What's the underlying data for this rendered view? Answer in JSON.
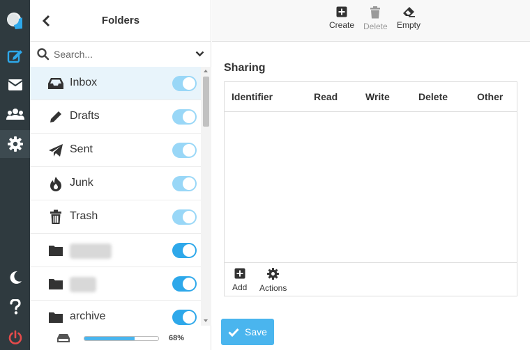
{
  "rail": {
    "items": [
      {
        "name": "logo-icon"
      },
      {
        "name": "compose-icon"
      },
      {
        "name": "mail-icon"
      },
      {
        "name": "contacts-icon"
      },
      {
        "name": "settings-icon",
        "active": true
      },
      {
        "name": "dark-mode-icon"
      },
      {
        "name": "help-icon"
      },
      {
        "name": "logout-icon"
      }
    ],
    "accent": "#2ea8ea",
    "logout_color": "#e54b4b"
  },
  "folders_panel": {
    "title": "Folders",
    "search_placeholder": "Search...",
    "folders": [
      {
        "name": "Inbox",
        "icon": "inbox-icon",
        "subscribed": true,
        "selected": true
      },
      {
        "name": "Drafts",
        "icon": "pencil-icon",
        "subscribed": true
      },
      {
        "name": "Sent",
        "icon": "paper-plane-icon",
        "subscribed": true
      },
      {
        "name": "Junk",
        "icon": "fire-icon",
        "subscribed": true
      },
      {
        "name": "Trash",
        "icon": "trash-icon",
        "subscribed": true
      },
      {
        "name": "",
        "icon": "folder-icon",
        "subscribed": true,
        "redacted": true
      },
      {
        "name": "",
        "icon": "folder-icon",
        "subscribed": true,
        "redacted": true
      },
      {
        "name": "archive",
        "icon": "folder-icon",
        "subscribed": true
      }
    ],
    "quota_percent": 68,
    "quota_label": "68%"
  },
  "toolbar": {
    "create_label": "Create",
    "delete_label": "Delete",
    "empty_label": "Empty"
  },
  "sharing": {
    "title": "Sharing",
    "columns": [
      "Identifier",
      "Read",
      "Write",
      "Delete",
      "Other"
    ],
    "rows": [],
    "add_label": "Add",
    "actions_label": "Actions"
  },
  "save_label": "Save"
}
